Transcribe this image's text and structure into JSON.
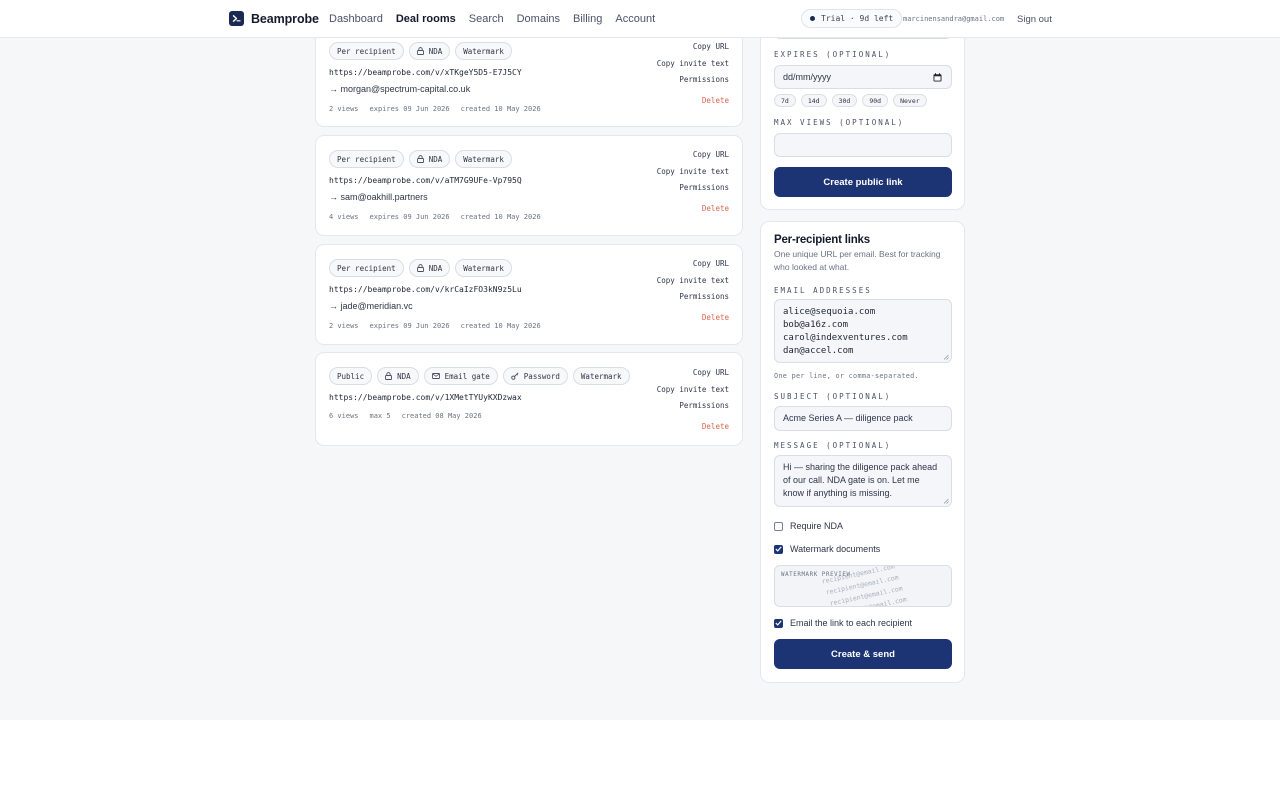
{
  "nav": {
    "brand": "Beamprobe",
    "items": [
      {
        "label": "Dashboard"
      },
      {
        "label": "Deal rooms"
      },
      {
        "label": "Search"
      },
      {
        "label": "Domains"
      },
      {
        "label": "Billing"
      },
      {
        "label": "Account"
      }
    ],
    "active": "Deal rooms",
    "trial": "Trial · 9d left",
    "email": "marcinensandra@gmail.com",
    "sign_out": "Sign out"
  },
  "actions": {
    "copy_url": "Copy URL",
    "copy_invite": "Copy invite text",
    "permissions": "Permissions",
    "delete": "Delete"
  },
  "links": [
    {
      "chips": [
        "Per recipient",
        "NDA",
        "Watermark"
      ],
      "url": "https://beamprobe.com/v/xTKgeY5D5-E7J5CY",
      "recipient": "→ morgan@spectrum-capital.co.uk",
      "meta": [
        "2 views",
        "expires 09 Jun 2026",
        "created 10 May 2026"
      ]
    },
    {
      "chips": [
        "Per recipient",
        "NDA",
        "Watermark"
      ],
      "url": "https://beamprobe.com/v/aTM7G9UFe-Vp795Q",
      "recipient": "→ sam@oakhill.partners",
      "meta": [
        "4 views",
        "expires 09 Jun 2026",
        "created 10 May 2026"
      ]
    },
    {
      "chips": [
        "Per recipient",
        "NDA",
        "Watermark"
      ],
      "url": "https://beamprobe.com/v/krCaIzFO3kN9z5Lu",
      "recipient": "→ jade@meridian.vc",
      "meta": [
        "2 views",
        "expires 09 Jun 2026",
        "created 10 May 2026"
      ]
    },
    {
      "chips": [
        "Public",
        "NDA",
        "Email gate",
        "Password",
        "Watermark"
      ],
      "url": "https://beamprobe.com/v/1XMetTYUyKXDzwax",
      "recipient": "",
      "meta": [
        "6 views",
        "max 5",
        "created 08 May 2026"
      ]
    }
  ],
  "public_form": {
    "expires_label": "EXPIRES (OPTIONAL)",
    "expires_placeholder": "dd/mm/yyyy",
    "quick_expiry": [
      "7d",
      "14d",
      "30d",
      "90d",
      "Never"
    ],
    "max_views_label": "MAX VIEWS (OPTIONAL)",
    "max_views_value": "",
    "submit": "Create public link"
  },
  "recipient_form": {
    "title": "Per-recipient links",
    "description": "One unique URL per email. Best for tracking who looked at what.",
    "emails_label": "EMAIL ADDRESSES",
    "emails": [
      "alice@sequoia.com",
      "bob@a16z.com",
      "carol@indexventures.com",
      "dan@accel.com"
    ],
    "emails_helper": "One per line, or comma-separated.",
    "subject_label": "SUBJECT (OPTIONAL)",
    "subject_value": "Acme Series A — diligence pack",
    "message_label": "MESSAGE (OPTIONAL)",
    "message_value": "Hi — sharing the diligence pack ahead of our call. NDA gate is on. Let me know if anything is missing.",
    "require_nda": {
      "label": "Require NDA",
      "checked": false
    },
    "watermark_docs": {
      "label": "Watermark documents",
      "checked": true
    },
    "watermark_preview_label": "WATERMARK PREVIEW",
    "watermark_lines": [
      "recipient@email.com",
      "recipient@email.com",
      "recipient@email.com",
      "recipient@email.com"
    ],
    "email_link": {
      "label": "Email the link to each recipient",
      "checked": true
    },
    "submit": "Create & send"
  },
  "colors": {
    "primary": "#1d3474",
    "brand": "#1b2a52",
    "danger": "#d9654b",
    "page_bg": "#f6f7f9"
  }
}
